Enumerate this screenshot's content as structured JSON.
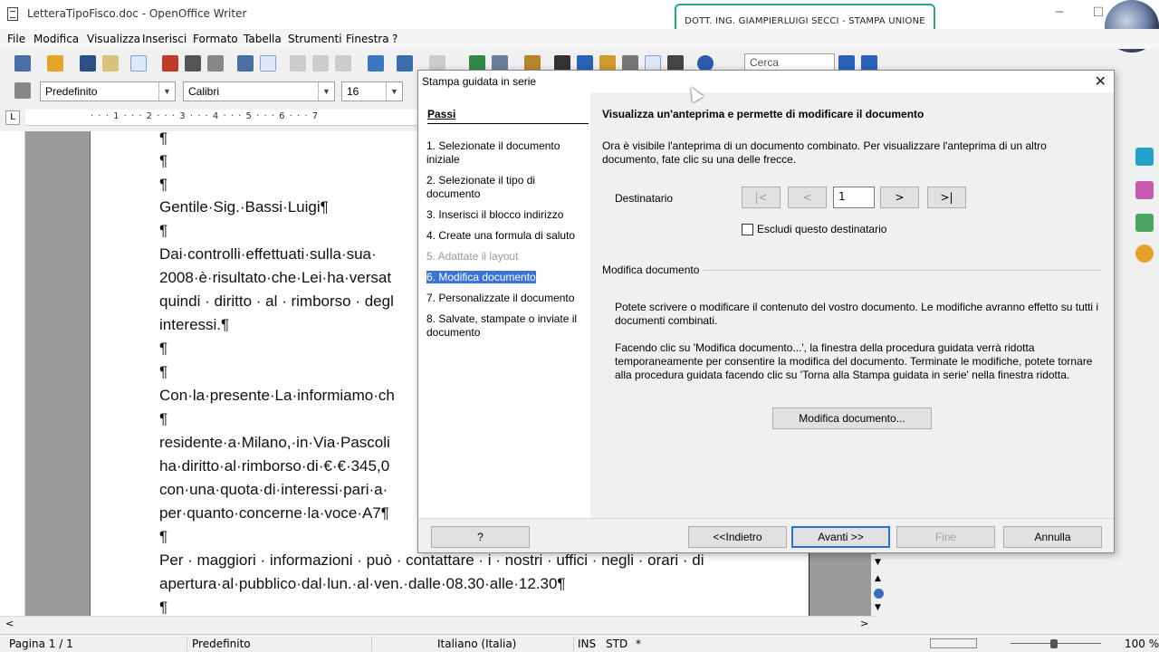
{
  "window": {
    "title": "LetteraTipoFisco.doc - OpenOffice Writer",
    "minimize": "─",
    "maximize": "☐"
  },
  "banner": {
    "text": "DOTT. ING. GIAMPIERLUIGI SECCI - STAMPA UNIONE"
  },
  "menu": [
    "File",
    "Modifica",
    "Visualizza",
    "Inserisci",
    "Formato",
    "Tabella",
    "Strumenti",
    "Finestra",
    "?"
  ],
  "format": {
    "style": "Predefinito",
    "font": "Calibri",
    "size": "16"
  },
  "search": {
    "placeholder": "Cerca"
  },
  "ruler": {
    "marks": "· · · 1 · · · 2 · · · 3 · · · 4 · · · 5 · · · 6 · · · 7"
  },
  "document": {
    "lines": [
      "¶",
      "¶",
      "¶",
      "Gentile·Sig.·Bassi·Luigi¶",
      "¶",
      "Dai·controlli·effettuati·sulla·sua·",
      "2008·è·risultato·che·Lei·ha·versat",
      "quindi · diritto · al · rimborso · degl",
      "interessi.¶",
      "¶",
      "¶",
      "Con·la·presente·La·informiamo·ch",
      "¶",
      "residente·a·Milano,·in·Via·Pascoli",
      "ha·diritto·al·rimborso·di·€·€·345,0",
      "con·una·quota·di·interessi·pari·a·",
      "per·quanto·concerne·la·voce·A7¶",
      "¶",
      "Per · maggiori · informazioni · può · contattare · i · nostri · uffici · negli · orari · di",
      "apertura·al·pubblico·dal·lun.·al·ven.·dalle·08.30·alle·12.30¶",
      "¶"
    ]
  },
  "dialog": {
    "title": "Stampa guidata in serie",
    "steps_header": "Passi",
    "steps": [
      {
        "label": "1. Selezionate il documento iniziale",
        "state": "normal"
      },
      {
        "label": "2. Selezionate il tipo di documento",
        "state": "normal"
      },
      {
        "label": "3. Inserisci il blocco indirizzo",
        "state": "normal"
      },
      {
        "label": "4. Create una formula di saluto",
        "state": "normal"
      },
      {
        "label": "5. Adattate il layout",
        "state": "disabled"
      },
      {
        "label": "6. Modifica documento",
        "state": "active"
      },
      {
        "label": "7. Personalizzate il documento",
        "state": "normal"
      },
      {
        "label": "8. Salvate, stampate o inviate il documento",
        "state": "normal"
      }
    ],
    "heading": "Visualizza un'anteprima e permette di modificare il documento",
    "intro": "Ora è visibile l'anteprima di un documento combinato. Per visualizzare l'anteprima di un altro documento, fate clic su una delle frecce.",
    "recipient_label": "Destinatario",
    "nav": {
      "first": "|<",
      "prev": "<",
      "value": "1",
      "next": ">",
      "last": ">|"
    },
    "exclude_label": "Escludi questo destinatario",
    "section_title": "Modifica documento",
    "para1": "Potete scrivere o modificare il contenuto del vostro documento. Le modifiche avranno effetto su tutti i documenti combinati.",
    "para2": "Facendo clic su 'Modifica documento...', la finestra della procedura guidata verrà ridotta temporaneamente per consentire la modifica del documento. Terminate le modifiche, potete tornare alla procedura guidata facendo clic su 'Torna alla Stampa guidata in serie' nella finestra ridotta.",
    "edit_button": "Modifica documento...",
    "help_button": "?",
    "back_button": "<<Indietro",
    "next_button": "Avanti >>",
    "finish_button": "Fine",
    "cancel_button": "Annulla"
  },
  "status": {
    "page": "Pagina 1 / 1",
    "style": "Predefinito",
    "language": "Italiano (Italia)",
    "ins": "INS",
    "std": "STD",
    "star": "*",
    "zoom": "100 %"
  },
  "colors": {
    "accent": "#3b73d8",
    "banner_border": "#2aa58a"
  }
}
